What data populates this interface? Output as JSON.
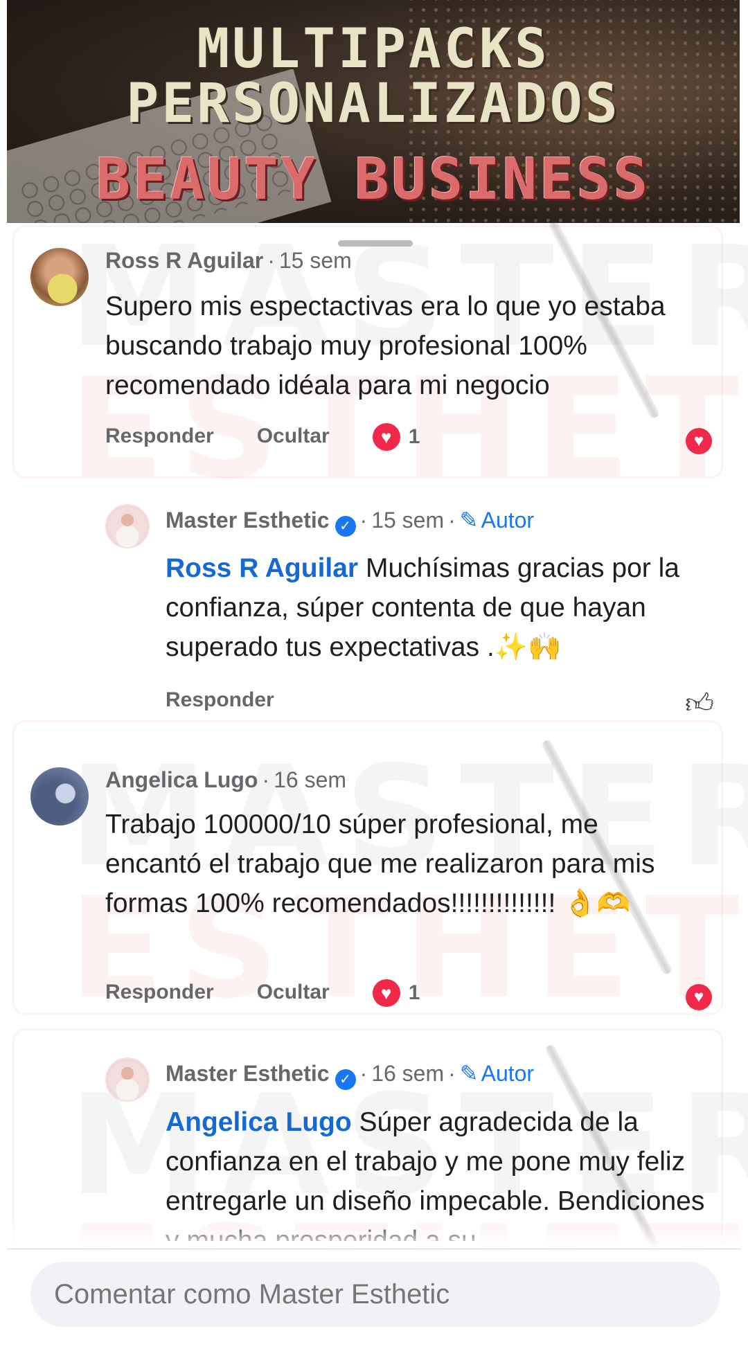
{
  "banner": {
    "line1": "MULTIPACKS",
    "line2": "PERSONALIZADOS",
    "line3": "BEAUTY BUSINESS"
  },
  "watermark": {
    "line1": "MASTER",
    "line2": "ESTHETIC"
  },
  "comments": [
    {
      "author": "Ross R Aguilar",
      "time": "15 sem",
      "text": "Supero mis espectactivas era lo que yo estaba buscando trabajo muy profesional 100% recomendado idéala para mi negocio",
      "actions": {
        "reply": "Responder",
        "hide": "Ocultar"
      },
      "reaction_icon": "heart-icon",
      "reaction_count": "1"
    },
    {
      "author": "Master Esthetic",
      "verified": true,
      "time": "15 sem",
      "role": "Autor",
      "mention": "Ross R Aguilar",
      "text": "Muchísimas gracias por la confianza, súper contenta de que hayan superado tus expectativas .✨🙌",
      "actions": {
        "reply": "Responder"
      },
      "reaction_icon": "thumbs-up-icon"
    },
    {
      "author": "Angelica Lugo",
      "time": "16 sem",
      "text": "Trabajo 100000/10 súper profesional, me encantó el trabajo que me realizaron para mis formas 100% recomendados!!!!!!!!!!!!!! 👌🫶",
      "actions": {
        "reply": "Responder",
        "hide": "Ocultar"
      },
      "reaction_icon": "heart-icon",
      "reaction_count": "1"
    },
    {
      "author": "Master Esthetic",
      "verified": true,
      "time": "16 sem",
      "role": "Autor",
      "mention": "Angelica Lugo",
      "text": "Súper agradecida de la confianza en el trabajo y me pone muy feliz entregarle un diseño impecable. Bendiciones y mucha prosperidad a su"
    }
  ],
  "composer": {
    "placeholder": "Comentar como Master Esthetic"
  },
  "colors": {
    "accent": "#1877f2",
    "heart": "#f0284a",
    "mention": "#1668d2"
  }
}
